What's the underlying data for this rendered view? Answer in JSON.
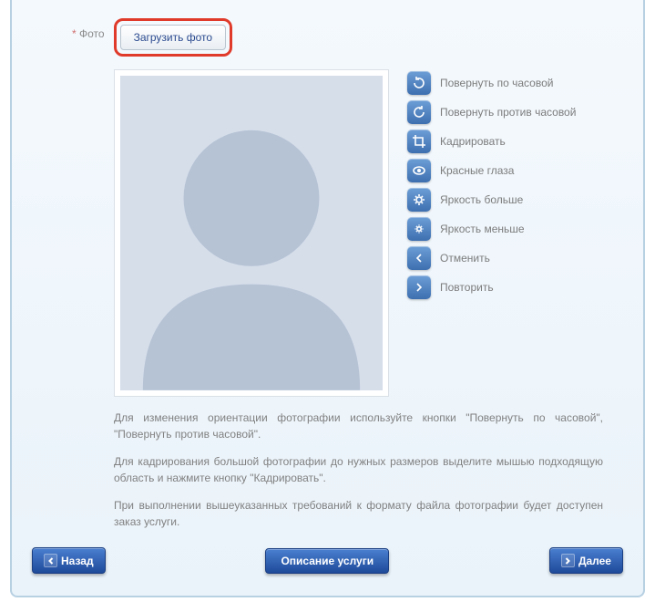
{
  "field": {
    "label": "Фото"
  },
  "upload": {
    "button_label": "Загрузить фото"
  },
  "tools": [
    {
      "icon": "rotate-cw-icon",
      "label": "Повернуть по часовой"
    },
    {
      "icon": "rotate-ccw-icon",
      "label": "Повернуть против часовой"
    },
    {
      "icon": "crop-icon",
      "label": "Кадрировать"
    },
    {
      "icon": "redeye-icon",
      "label": "Красные глаза"
    },
    {
      "icon": "brightness-up-icon",
      "label": "Яркость больше"
    },
    {
      "icon": "brightness-down-icon",
      "label": "Яркость меньше"
    },
    {
      "icon": "undo-icon",
      "label": "Отменить"
    },
    {
      "icon": "redo-icon",
      "label": "Повторить"
    }
  ],
  "instructions": {
    "p1": "Для изменения ориентации фотографии используйте кнопки \"Повернуть по часовой\", \"Повернуть против часовой\".",
    "p2": "Для кадрирования большой фотографии до нужных размеров выделите мышью подходящую область и нажмите кнопку \"Кадрировать\".",
    "p3": "При выполнении вышеуказанных требований к формату файла фотографии будет доступен заказ услуги."
  },
  "nav": {
    "back": "Назад",
    "description": "Описание услуги",
    "next": "Далее"
  }
}
